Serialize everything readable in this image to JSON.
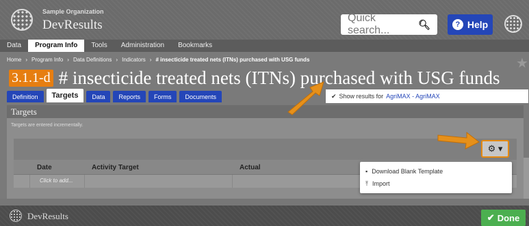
{
  "header": {
    "organization": "Sample Organization",
    "app_name": "DevResults",
    "search_placeholder": "Quick search...",
    "help_label": "Help"
  },
  "nav": [
    "Data",
    "Program Info",
    "Tools",
    "Administration",
    "Bookmarks"
  ],
  "breadcrumb": [
    "Home",
    "Program Info",
    "Data Definitions",
    "Indicators",
    "# insecticide treated nets (ITNs) purchased with USG funds"
  ],
  "indicator": {
    "code": "3.1.1-d",
    "title": "# insecticide treated nets (ITNs) purchased with USG funds"
  },
  "tabs": [
    "Definition",
    "Targets",
    "Data",
    "Reports",
    "Forms",
    "Documents"
  ],
  "show_results": {
    "prefix": "Show results for",
    "link": "AgriMAX - AgriMAX"
  },
  "targets": {
    "heading": "Targets",
    "note": "Targets are entered incrementally.",
    "columns": [
      "Date",
      "Activity Target",
      "Actual"
    ],
    "add_placeholder": "Click to add..."
  },
  "menu": {
    "items": [
      "Download Blank Template",
      "Import"
    ]
  },
  "footer": {
    "app_name": "DevResults",
    "done_label": "Done"
  },
  "colors": {
    "accent_blue": "#2446b8",
    "code_orange": "#e67e11",
    "done_green": "#4caf50"
  }
}
